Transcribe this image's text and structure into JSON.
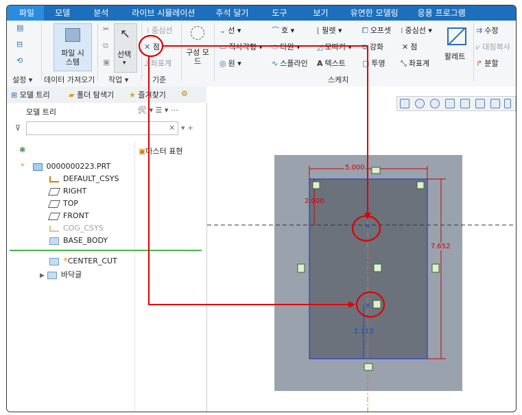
{
  "menu": {
    "items": [
      "파일",
      "모델",
      "분석",
      "라이브 시뮬레이션",
      "주석 달기",
      "도구",
      "보기",
      "유연한 모델링",
      "응용 프로그램"
    ]
  },
  "ribbon": {
    "setup": {
      "label": "설정 ▾"
    },
    "get_data": {
      "file_system": "파일 시\n스템",
      "label": "데이터 가져오기"
    },
    "operations": {
      "select": "선택",
      "label": "작업 ▾"
    },
    "datum": {
      "centerline": "중심선",
      "point": "점",
      "coord": "좌표계",
      "label": "기준"
    },
    "construct_mode": {
      "label": "구성 모\n드"
    },
    "sketch": {
      "line": "선 ▾",
      "rectangle": "직사각형 ▾",
      "circle": "원 ▾",
      "arc": "호 ▾",
      "ellipse": "타원 ▾",
      "spline": "스플라인",
      "fillet": "필렛 ▾",
      "chamfer": "모따기 ▾",
      "text": "텍스트",
      "offset": "오프셋",
      "thicken": "강화",
      "project": "투영",
      "centerline": "중심선 ▾",
      "point": "점",
      "coord": "좌표계",
      "palette": "팔레트",
      "label": "스케치"
    },
    "edit": {
      "modify": "수정",
      "mirror": "대칭복사",
      "divide": "분할"
    }
  },
  "left_tabs": {
    "model_tree": "모델 트리",
    "folder_browser": "폴더 탐색기",
    "favorites": "즐겨찾기"
  },
  "model_tree": {
    "header": "모델 트리",
    "column": "마스터 표현",
    "items": [
      {
        "label": "0000000223.PRT"
      },
      {
        "label": "DEFAULT_CSYS"
      },
      {
        "label": "RIGHT"
      },
      {
        "label": "TOP"
      },
      {
        "label": "FRONT"
      },
      {
        "label": "COG_CSYS"
      },
      {
        "label": "BASE_BODY"
      },
      {
        "label": "CENTER_CUT"
      },
      {
        "label": "바닥글"
      }
    ]
  },
  "sketch_dims": {
    "width": "5.000",
    "top_offset": "2.000",
    "height": "7.652",
    "bottom_offset": "2.313"
  },
  "colors": {
    "menubar": "#1d6fbd",
    "accent_red": "#e00000",
    "sketch_blue": "#2040d8",
    "dim_red": "#d00000"
  }
}
